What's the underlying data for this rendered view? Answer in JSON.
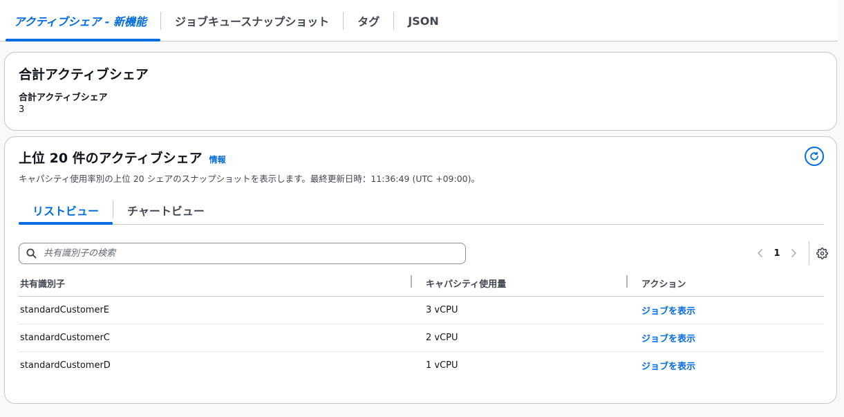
{
  "top_tabs": [
    {
      "label": "アクティブシェア - 新機能"
    },
    {
      "label": "ジョブキュースナップショット"
    },
    {
      "label": "タグ"
    },
    {
      "label": "JSON"
    }
  ],
  "total_card": {
    "title": "合計アクティブシェア",
    "label": "合計アクティブシェア",
    "value": "3"
  },
  "top_card": {
    "title": "上位 20 件のアクティブシェア",
    "info": "情報",
    "description": "キャパシティ使用率別の上位 20 シェアのスナップショットを表示します。最終更新日時：11:36:49 (UTC +09:00)。",
    "refresh_icon": "refresh-icon",
    "sub_tabs": [
      {
        "label": "リストビュー"
      },
      {
        "label": "チャートビュー"
      }
    ],
    "search": {
      "placeholder": "共有識別子の検索",
      "value": ""
    },
    "pagination": {
      "current_page": "1"
    },
    "columns": [
      "共有識別子",
      "キャパシティ使用量",
      "アクション"
    ],
    "rows": [
      {
        "id": "standardCustomerE",
        "capacity": "3 vCPU",
        "action": "ジョブを表示"
      },
      {
        "id": "standardCustomerC",
        "capacity": "2 vCPU",
        "action": "ジョブを表示"
      },
      {
        "id": "standardCustomerD",
        "capacity": "1 vCPU",
        "action": "ジョブを表示"
      }
    ]
  },
  "colors": {
    "accent": "#006ce0",
    "text": "#0f141a",
    "secondary_text": "#424650",
    "border": "#c6c6cd"
  }
}
